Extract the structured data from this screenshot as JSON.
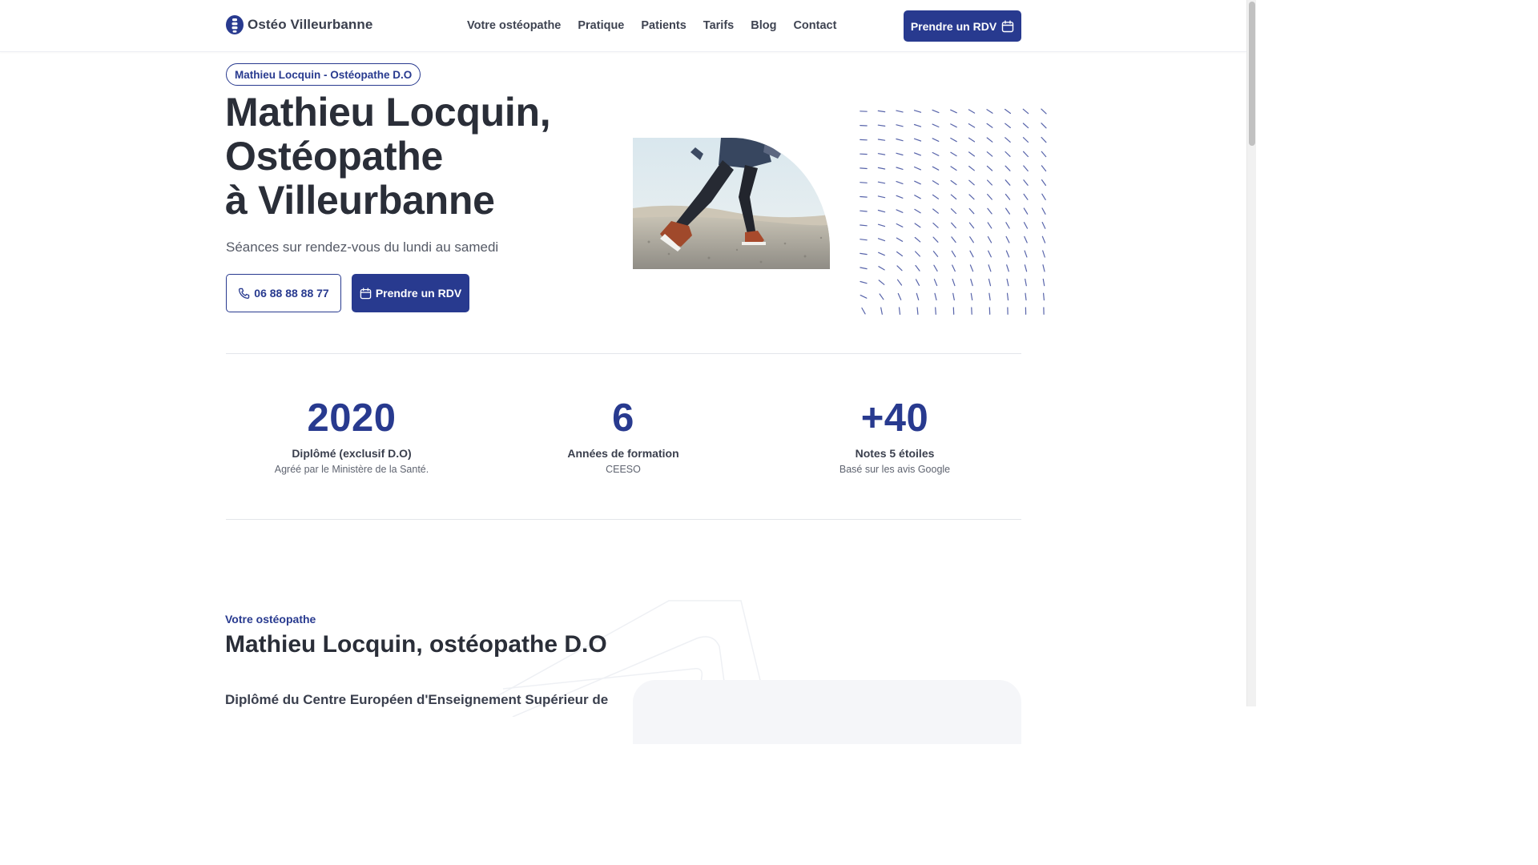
{
  "brand": {
    "name": "Ostéo Villeurbanne",
    "icon": "spine-logo-icon",
    "color": "#283a8f"
  },
  "nav": {
    "items": [
      "Votre ostéopathe",
      "Pratique",
      "Patients",
      "Tarifs",
      "Blog",
      "Contact"
    ],
    "cta_label": "Prendre un RDV",
    "cta_icon": "calendar-icon"
  },
  "hero": {
    "badge": "Mathieu Locquin - Ostéopathe D.O",
    "title_lines": [
      "Mathieu Locquin,",
      "Ostéopathe",
      "à Villeurbanne"
    ],
    "subtitle": "Séances sur rendez-vous du lundi au samedi",
    "phone_label": "06 88 88 88 77",
    "phone_icon": "phone-icon",
    "rdv_label": "Prendre un RDV",
    "rdv_icon": "calendar-icon",
    "image": "runner-photo",
    "pattern": "dash-field-pattern"
  },
  "stats": [
    {
      "value": "2020",
      "label": "Diplômé (exclusif D.O)",
      "desc": "Agréé par le Ministère de la Santé."
    },
    {
      "value": "6",
      "label": "Années de formation",
      "desc": "CEESO"
    },
    {
      "value": "+40",
      "label": "Notes 5 étoiles",
      "desc": "Basé sur les avis Google"
    }
  ],
  "about": {
    "eyebrow": "Votre ostéopathe",
    "title": "Mathieu Locquin, ostéopathe D.O",
    "body": "Diplômé du Centre Européen d'Enseignement Supérieur de"
  }
}
